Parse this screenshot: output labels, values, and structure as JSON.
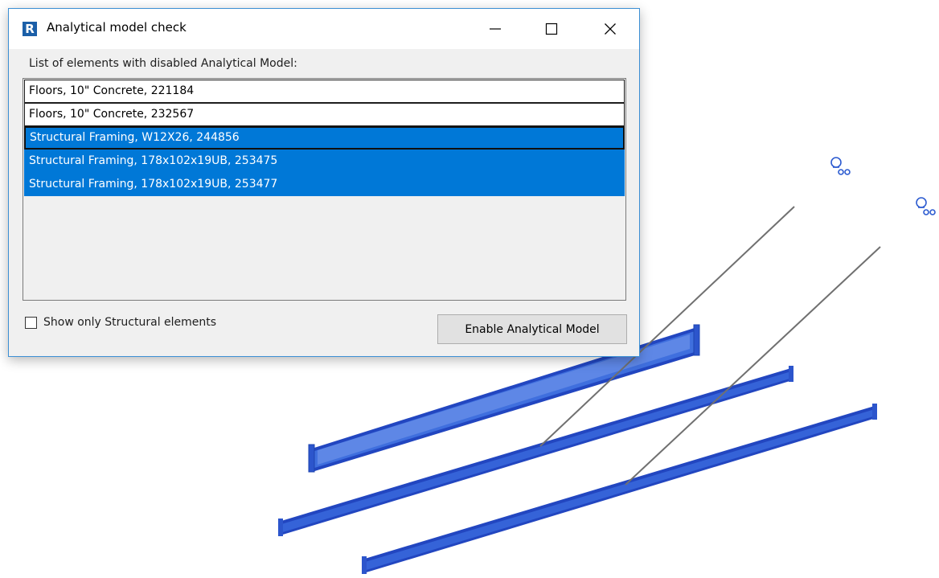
{
  "dialog": {
    "app_icon_letter": "R",
    "title": "Analytical model check",
    "list_label": "List of elements with disabled Analytical Model:",
    "items": [
      {
        "label": "Floors, 10\" Concrete, 221184",
        "selected": false
      },
      {
        "label": "Floors, 10\" Concrete, 232567",
        "selected": false
      },
      {
        "label": "Structural Framing, W12X26, 244856",
        "selected": true
      },
      {
        "label": "Structural Framing, 178x102x19UB, 253475",
        "selected": true
      },
      {
        "label": "Structural Framing, 178x102x19UB, 253477",
        "selected": true
      }
    ],
    "checkbox_label": "Show only Structural elements",
    "checkbox_checked": false,
    "enable_button_label": "Enable Analytical Model"
  },
  "colors": {
    "selection": "#0078d7",
    "beam_fill": "#2f5fd6",
    "analytical_line": "#707070",
    "dialog_bg": "#f0f0f0"
  }
}
